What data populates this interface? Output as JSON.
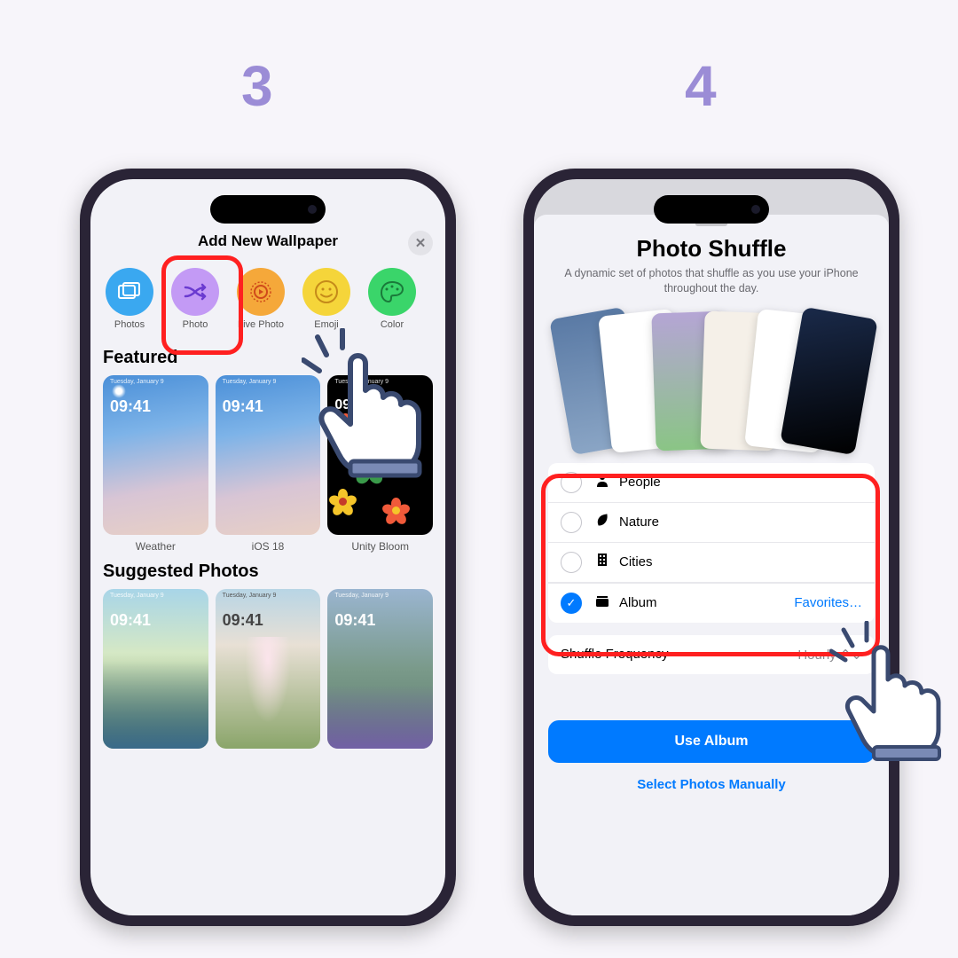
{
  "steps": {
    "left": "3",
    "right": "4"
  },
  "left": {
    "title": "Add New Wallpaper",
    "categories": [
      {
        "label": "Photos",
        "bg": "#3aa8f0",
        "icon": "🖼"
      },
      {
        "label": "Photo",
        "bg": "#c39af5",
        "icon": "✕"
      },
      {
        "label": "Live Photo",
        "bg": "#f5a83a",
        "icon": "◉"
      },
      {
        "label": "Emoji",
        "bg": "#f5d53a",
        "icon": "😀"
      },
      {
        "label": "Color",
        "bg": "#3ad56a",
        "icon": "🎨"
      }
    ],
    "featured_title": "Featured",
    "featured": [
      {
        "label": "Weather",
        "time": "09:41",
        "date": "Tuesday, January 9"
      },
      {
        "label": "iOS 18",
        "time": "09:41",
        "date": "Tuesday, January 9"
      },
      {
        "label": "Unity Bloom",
        "time": "09:41",
        "date": "Tuesday, January 9"
      }
    ],
    "suggested_title": "Suggested Photos",
    "suggested_time": "09:41",
    "suggested_date": "Tuesday, January 9"
  },
  "right": {
    "title": "Photo Shuffle",
    "subtitle": "A dynamic set of photos that shuffle as you use your iPhone throughout the day.",
    "options": [
      {
        "label": "People",
        "icon": "👤",
        "checked": false
      },
      {
        "label": "Nature",
        "icon": "🍃",
        "checked": false
      },
      {
        "label": "Cities",
        "icon": "🏙",
        "checked": false
      },
      {
        "label": "Album",
        "icon": "📚",
        "checked": true,
        "value": "Favorites…"
      }
    ],
    "frequency": {
      "label": "Shuffle Frequency",
      "value": "Hourly"
    },
    "primary": "Use Album",
    "secondary": "Select Photos Manually"
  }
}
